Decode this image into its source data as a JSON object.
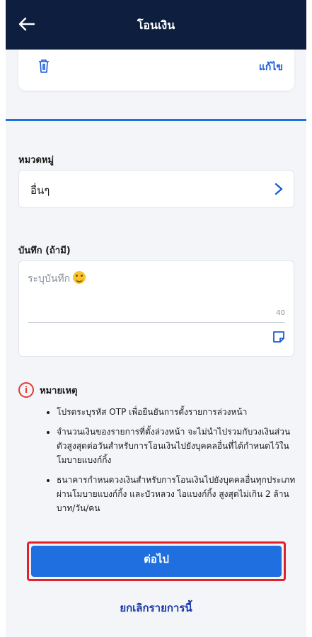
{
  "header": {
    "title": "โอนเงิน"
  },
  "card": {
    "edit_label": "แก้ไข"
  },
  "category": {
    "label": "หมวดหมู่",
    "value": "อื่นๆ"
  },
  "note": {
    "label": "บันทึก (ถ้ามี)",
    "placeholder": "ระบุบันทึก",
    "max_chars": "40"
  },
  "remarks": {
    "title": "หมายเหตุ",
    "items": [
      "โปรดระบุรหัส OTP เพื่อยืนยันการตั้งรายการล่วงหน้า",
      "จำนวนเงินของรายการที่ตั้งล่วงหน้า จะไม่นำไปรวมกับวงเงินส่วนตัวสูงสุดต่อวันสำหรับการโอนเงินไปยังบุคคลอื่นที่ได้กำหนดไว้ในโมบายแบงก์กิ้ง",
      "ธนาคารกำหนดวงเงินสำหรับการโอนเงินไปยังบุคคลอื่นทุกประเภทผ่านโมบายแบงก์กิ้ง และบัวหลวง ไอแบงก์กิ้ง สูงสุดไม่เกิน 2 ล้านบาท/วัน/คน"
    ]
  },
  "actions": {
    "next_label": "ต่อไป",
    "cancel_label": "ยกเลิกรายการนี้"
  },
  "colors": {
    "header_bg": "#0d1e3e",
    "accent_blue": "#1f6fe0",
    "highlight_red": "#e5202a"
  },
  "icons": [
    "back-arrow-icon",
    "trash-icon",
    "chevron-right-icon",
    "smiley-emoji-icon",
    "note-edit-icon",
    "info-icon"
  ]
}
